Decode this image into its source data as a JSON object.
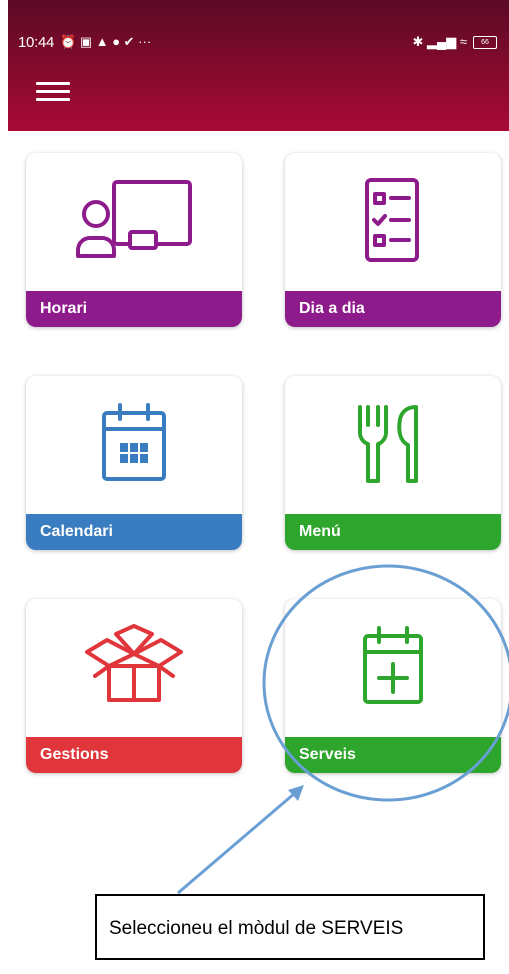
{
  "status_bar": {
    "time": "10:44",
    "notif_glyphs": "⏰ ▣ ▲ ● ✔ ···",
    "sys_glyphs": "✱ ▂▄▆ ≈",
    "battery": "66"
  },
  "tiles": [
    {
      "label": "Horari",
      "color": "#8e1b8c",
      "icon": "teacher-board-icon"
    },
    {
      "label": "Dia a dia",
      "color": "#8e1b8c",
      "icon": "checklist-icon"
    },
    {
      "label": "Calendari",
      "color": "#3a7cc0",
      "icon": "calendar-icon"
    },
    {
      "label": "Menú",
      "color": "#2ea52c",
      "icon": "fork-knife-icon"
    },
    {
      "label": "Gestions",
      "color": "#e0353a",
      "icon": "open-box-icon"
    },
    {
      "label": "Serveis",
      "color": "#2ea52c",
      "icon": "calendar-add-icon"
    }
  ],
  "annotation": {
    "text": "Seleccioneu el mòdul de SERVEIS",
    "highlight_color": "#6a9fd4"
  }
}
